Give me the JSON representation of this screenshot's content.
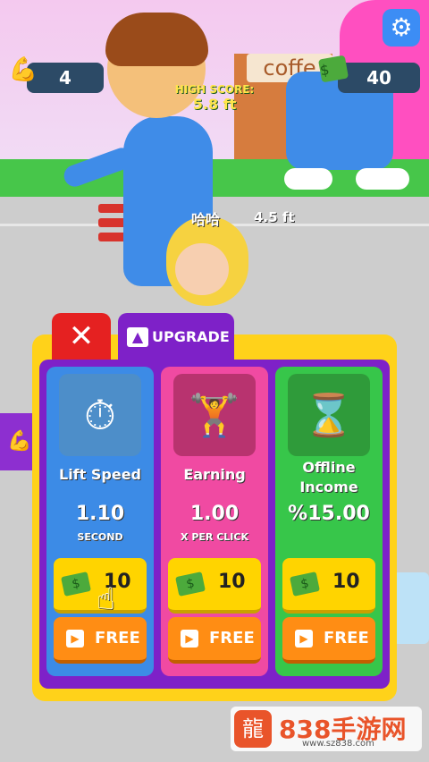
{
  "hud": {
    "strength_value": "4",
    "cash_value": "40",
    "settings_icon": "gear-icon",
    "strength_icon": "flexed-arm-icon",
    "cash_icon": "cash-stack-icon"
  },
  "scene": {
    "high_score_label": "HIGH SCORE:",
    "high_score_value": "5.8 ft",
    "shop_sign": "coffe",
    "partner_label": "哈哈",
    "partner_height": "4.5 ft"
  },
  "panel": {
    "close_icon": "close-icon",
    "tab_label": "UPGRADE",
    "cards": [
      {
        "title": "Lift Speed",
        "value": "1.10",
        "unit": "SECOND",
        "price": "10",
        "free_label": "FREE",
        "icon": "stopwatch-dumbbell-icon"
      },
      {
        "title": "Earning",
        "value": "1.00",
        "unit": "X PER CLICK",
        "price": "10",
        "free_label": "FREE",
        "icon": "dumbbell-plus-icon"
      },
      {
        "title": "Offline Income",
        "value": "%15.00",
        "unit": "",
        "price": "10",
        "free_label": "FREE",
        "icon": "hourglass-muscle-icon"
      }
    ]
  },
  "watermark": {
    "brand": "838手游网",
    "url": "www.sz838.com"
  },
  "colors": {
    "panel_frame": "#ffd21a",
    "panel_inner": "#7e21c8",
    "card_blue": "#3c8be6",
    "card_pink": "#f04aa2",
    "card_green": "#37c64a",
    "buy_button": "#ffd400",
    "free_button": "#ff8d14",
    "close_button": "#e52121"
  }
}
